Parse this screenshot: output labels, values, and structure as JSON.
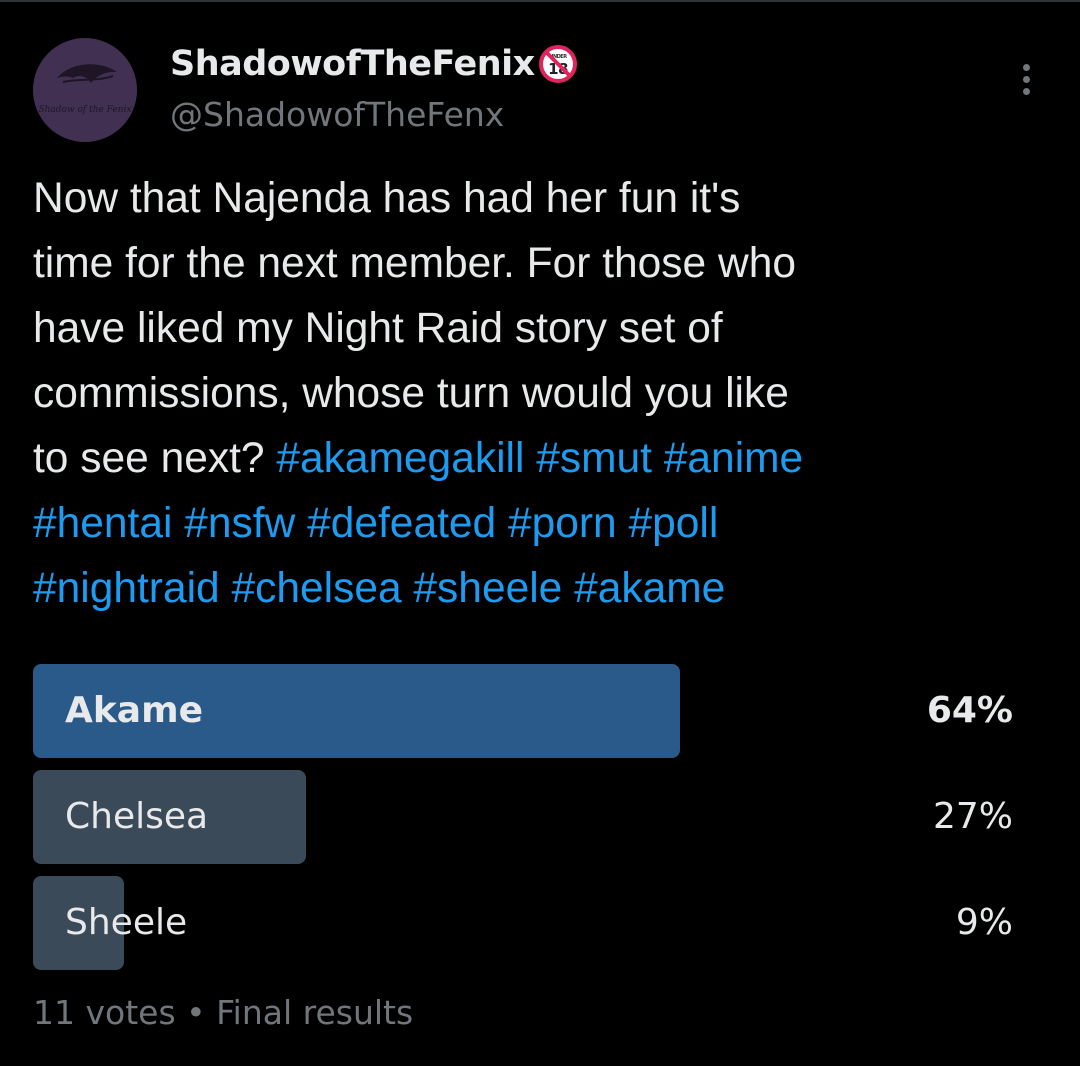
{
  "tweet": {
    "author": {
      "display_name": "ShadowofTheFenix",
      "handle": "@ShadowofTheFenx",
      "avatar_logo_text": "Shadow of the Fenix",
      "badge_icon": "under-18-icon",
      "badge_text": "UNDER 18"
    },
    "more_icon": "more-vertical-icon",
    "text_lines": [
      [
        {
          "t": "Now that Najenda has had her fun it's"
        }
      ],
      [
        {
          "t": "time for the next member. For those who"
        }
      ],
      [
        {
          "t": "have liked my Night Raid story set of"
        }
      ],
      [
        {
          "t": "commissions, whose turn would you like"
        }
      ],
      [
        {
          "t": "to see next? "
        },
        {
          "t": "#akamegakill",
          "tag": true
        },
        {
          "t": " "
        },
        {
          "t": "#smut",
          "tag": true
        },
        {
          "t": " "
        },
        {
          "t": "#anime",
          "tag": true
        }
      ],
      [
        {
          "t": "#hentai",
          "tag": true
        },
        {
          "t": " "
        },
        {
          "t": "#nsfw",
          "tag": true
        },
        {
          "t": " "
        },
        {
          "t": "#defeated",
          "tag": true
        },
        {
          "t": " "
        },
        {
          "t": "#porn",
          "tag": true
        },
        {
          "t": " "
        },
        {
          "t": "#poll",
          "tag": true
        }
      ],
      [
        {
          "t": "#nightraid",
          "tag": true
        },
        {
          "t": " "
        },
        {
          "t": "#chelsea",
          "tag": true
        },
        {
          "t": " "
        },
        {
          "t": "#sheele",
          "tag": true
        },
        {
          "t": " "
        },
        {
          "t": "#akame",
          "tag": true
        }
      ]
    ],
    "poll": {
      "options": [
        {
          "label": "Akame",
          "percent_text": "64%",
          "percent": 64,
          "leader": true
        },
        {
          "label": "Chelsea",
          "percent_text": "27%",
          "percent": 27,
          "leader": false
        },
        {
          "label": "Sheele",
          "percent_text": "9%",
          "percent": 9,
          "leader": false
        }
      ],
      "meta": "11 votes • Final results"
    }
  },
  "colors": {
    "background": "#000000",
    "text": "#e7e9ea",
    "secondary_text": "#71767b",
    "hashtag": "#1d9bf0",
    "poll_bar_leader": "#2a5a8a",
    "poll_bar": "#3b4a59",
    "avatar_bg": "#413051"
  }
}
